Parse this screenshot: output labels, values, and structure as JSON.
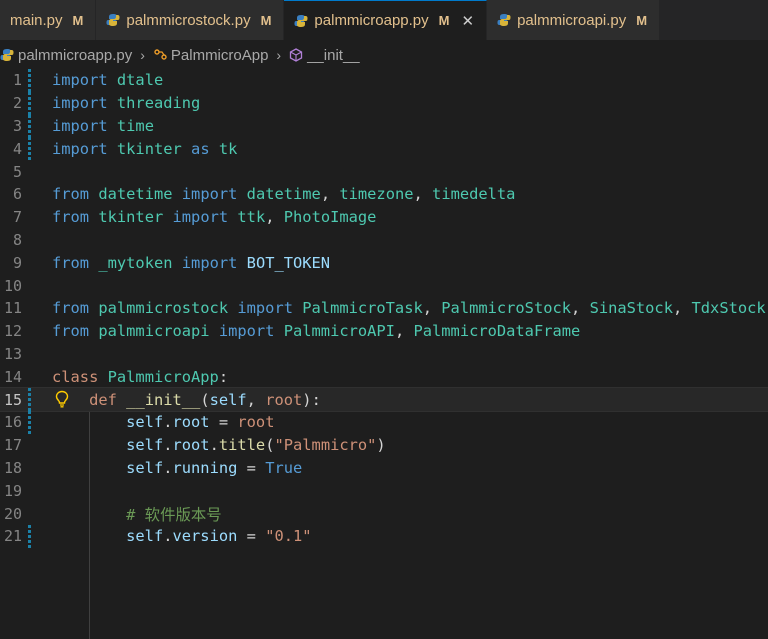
{
  "tabs": [
    {
      "label": "main.py",
      "badge": "M",
      "icon": "none",
      "active": false
    },
    {
      "label": "palmmicrostock.py",
      "badge": "M",
      "icon": "python-icon",
      "active": false
    },
    {
      "label": "palmmicroapp.py",
      "badge": "M",
      "icon": "python-icon",
      "active": true
    },
    {
      "label": "palmmicroapi.py",
      "badge": "M",
      "icon": "python-icon",
      "active": false
    }
  ],
  "breadcrumb": {
    "file": "palmmicroapp.py",
    "class": "PalmmicroApp",
    "method": "__init__"
  },
  "lines": [
    {
      "n": "1",
      "tokens": [
        [
          "kw2",
          "import"
        ],
        [
          "plain",
          " "
        ],
        [
          "mod-name",
          "dtale"
        ]
      ]
    },
    {
      "n": "2",
      "tokens": [
        [
          "kw2",
          "import"
        ],
        [
          "plain",
          " "
        ],
        [
          "mod-name",
          "threading"
        ]
      ]
    },
    {
      "n": "3",
      "tokens": [
        [
          "kw2",
          "import"
        ],
        [
          "plain",
          " "
        ],
        [
          "mod-name",
          "time"
        ]
      ]
    },
    {
      "n": "4",
      "tokens": [
        [
          "kw2",
          "import"
        ],
        [
          "plain",
          " "
        ],
        [
          "mod-name",
          "tkinter"
        ],
        [
          "plain",
          " "
        ],
        [
          "kw2",
          "as"
        ],
        [
          "plain",
          " "
        ],
        [
          "mod-name",
          "tk"
        ]
      ]
    },
    {
      "n": "5",
      "tokens": []
    },
    {
      "n": "6",
      "tokens": [
        [
          "kw2",
          "from"
        ],
        [
          "plain",
          " "
        ],
        [
          "mod-name",
          "datetime"
        ],
        [
          "plain",
          " "
        ],
        [
          "kw2",
          "import"
        ],
        [
          "plain",
          " "
        ],
        [
          "cls",
          "datetime"
        ],
        [
          "plain",
          ", "
        ],
        [
          "cls",
          "timezone"
        ],
        [
          "plain",
          ", "
        ],
        [
          "cls",
          "timedelta"
        ]
      ]
    },
    {
      "n": "7",
      "tokens": [
        [
          "kw2",
          "from"
        ],
        [
          "plain",
          " "
        ],
        [
          "mod-name",
          "tkinter"
        ],
        [
          "plain",
          " "
        ],
        [
          "kw2",
          "import"
        ],
        [
          "plain",
          " "
        ],
        [
          "mod-name",
          "ttk"
        ],
        [
          "plain",
          ", "
        ],
        [
          "cls",
          "PhotoImage"
        ]
      ]
    },
    {
      "n": "8",
      "tokens": []
    },
    {
      "n": "9",
      "tokens": [
        [
          "kw2",
          "from"
        ],
        [
          "plain",
          " "
        ],
        [
          "mod-name",
          "_mytoken"
        ],
        [
          "plain",
          " "
        ],
        [
          "kw2",
          "import"
        ],
        [
          "plain",
          " "
        ],
        [
          "ident",
          "BOT_TOKEN"
        ]
      ]
    },
    {
      "n": "10",
      "tokens": []
    },
    {
      "n": "11",
      "tokens": [
        [
          "kw2",
          "from"
        ],
        [
          "plain",
          " "
        ],
        [
          "mod-name",
          "palmmicrostock"
        ],
        [
          "plain",
          " "
        ],
        [
          "kw2",
          "import"
        ],
        [
          "plain",
          " "
        ],
        [
          "cls",
          "PalmmicroTask"
        ],
        [
          "plain",
          ", "
        ],
        [
          "cls",
          "PalmmicroStock"
        ],
        [
          "plain",
          ", "
        ],
        [
          "cls",
          "SinaStock"
        ],
        [
          "plain",
          ", "
        ],
        [
          "cls",
          "TdxStock"
        ]
      ]
    },
    {
      "n": "12",
      "tokens": [
        [
          "kw2",
          "from"
        ],
        [
          "plain",
          " "
        ],
        [
          "mod-name",
          "palmmicroapi"
        ],
        [
          "plain",
          " "
        ],
        [
          "kw2",
          "import"
        ],
        [
          "plain",
          " "
        ],
        [
          "cls",
          "PalmmicroAPI"
        ],
        [
          "plain",
          ", "
        ],
        [
          "cls",
          "PalmmicroDataFrame"
        ]
      ]
    },
    {
      "n": "13",
      "tokens": []
    },
    {
      "n": "14",
      "tokens": [
        [
          "str",
          "class"
        ],
        [
          "plain",
          " "
        ],
        [
          "cls",
          "PalmmicroApp"
        ],
        [
          "plain",
          ":"
        ]
      ]
    },
    {
      "n": "15",
      "tokens": [
        [
          "plain",
          "    "
        ],
        [
          "str",
          "def"
        ],
        [
          "plain",
          " "
        ],
        [
          "fn",
          "__init__"
        ],
        [
          "plain",
          "("
        ],
        [
          "self",
          "self"
        ],
        [
          "plain",
          ", "
        ],
        [
          "str",
          "root"
        ],
        [
          "plain",
          "):"
        ]
      ]
    },
    {
      "n": "16",
      "tokens": [
        [
          "plain",
          "        "
        ],
        [
          "self",
          "self"
        ],
        [
          "plain",
          "."
        ],
        [
          "ident",
          "root"
        ],
        [
          "plain",
          " = "
        ],
        [
          "str",
          "root"
        ]
      ]
    },
    {
      "n": "17",
      "tokens": [
        [
          "plain",
          "        "
        ],
        [
          "self",
          "self"
        ],
        [
          "plain",
          "."
        ],
        [
          "ident",
          "root"
        ],
        [
          "plain",
          "."
        ],
        [
          "fn",
          "title"
        ],
        [
          "plain",
          "("
        ],
        [
          "str",
          "\"Palmmicro\""
        ],
        [
          "plain",
          ")"
        ]
      ]
    },
    {
      "n": "18",
      "tokens": [
        [
          "plain",
          "        "
        ],
        [
          "self",
          "self"
        ],
        [
          "plain",
          "."
        ],
        [
          "ident",
          "running"
        ],
        [
          "plain",
          " = "
        ],
        [
          "kw2",
          "True"
        ]
      ]
    },
    {
      "n": "19",
      "tokens": []
    },
    {
      "n": "20",
      "tokens": [
        [
          "plain",
          "        "
        ],
        [
          "cmt",
          "# 软件版本号"
        ]
      ]
    },
    {
      "n": "21",
      "tokens": [
        [
          "plain",
          "        "
        ],
        [
          "self",
          "self"
        ],
        [
          "plain",
          "."
        ],
        [
          "ident",
          "version"
        ],
        [
          "plain",
          " = "
        ],
        [
          "str",
          "\"0.1\""
        ]
      ]
    }
  ],
  "modified_lines": [
    "1",
    "2",
    "3",
    "4",
    "15",
    "16",
    "21"
  ],
  "current_line": "15",
  "colors": {
    "accent": "#007acc",
    "modified": "#e2c08d",
    "gutter_mod": "#1b81a8"
  }
}
